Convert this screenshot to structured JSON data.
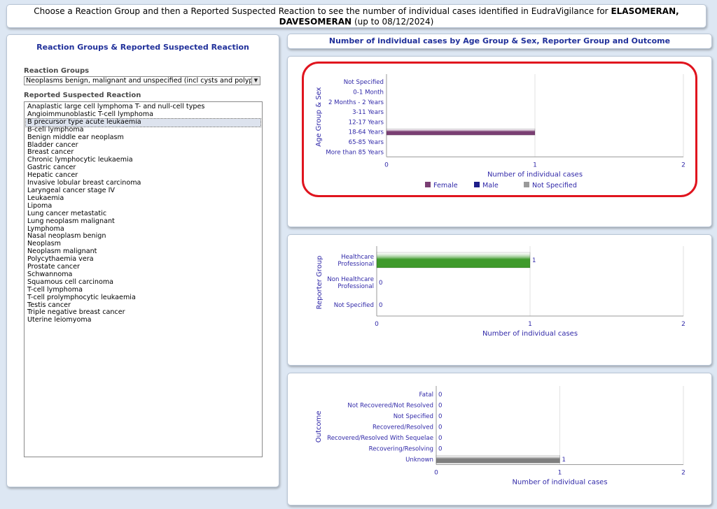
{
  "header": {
    "text": "Choose a Reaction Group and then a Reported Suspected Reaction to see the number of individual cases identified in EudraVigilance for",
    "product": "ELASOMERAN, DAVESOMERAN",
    "date_note": "(up to 08/12/2024)"
  },
  "left_panel": {
    "title": "Reaction Groups & Reported Suspected Reaction",
    "reaction_groups_label": "Reaction Groups",
    "reaction_group_selected": "Neoplasms benign, malignant and unspecified (incl cysts and polyps)",
    "reported_reaction_label": "Reported Suspected Reaction",
    "selected_reaction": "B precursor type acute leukaemia",
    "reactions": [
      "Anaplastic large cell lymphoma T- and null-cell types",
      "Angioimmunoblastic T-cell lymphoma",
      "B precursor type acute leukaemia",
      "B-cell lymphoma",
      "Benign middle ear neoplasm",
      "Bladder cancer",
      "Breast cancer",
      "Chronic lymphocytic leukaemia",
      "Gastric cancer",
      "Hepatic cancer",
      "Invasive lobular breast carcinoma",
      "Laryngeal cancer stage IV",
      "Leukaemia",
      "Lipoma",
      "Lung cancer metastatic",
      "Lung neoplasm malignant",
      "Lymphoma",
      "Nasal neoplasm benign",
      "Neoplasm",
      "Neoplasm malignant",
      "Polycythaemia vera",
      "Prostate cancer",
      "Schwannoma",
      "Squamous cell carcinoma",
      "T-cell lymphoma",
      "T-cell prolymphocytic leukaemia",
      "Testis cancer",
      "Triple negative breast cancer",
      "Uterine leiomyoma"
    ]
  },
  "right_title": "Number of individual cases by Age Group & Sex, Reporter Group and Outcome",
  "colors": {
    "female": "#7a3f73",
    "male": "#1e1e8a",
    "not_specified": "#9a9a9a",
    "reporter_bar": "#3f9a2c",
    "outcome_bar": "#7f7f7f",
    "axis_text": "#3028a8",
    "highlight": "#e0141e"
  },
  "chart_data": [
    {
      "type": "bar",
      "orientation": "horizontal",
      "categories": [
        "Not Specified",
        "0-1 Month",
        "2 Months - 2 Years",
        "3-11 Years",
        "12-17 Years",
        "18-64 Years",
        "65-85 Years",
        "More than 85 Years"
      ],
      "series": [
        {
          "name": "Female",
          "values": [
            0,
            0,
            0,
            0,
            0,
            1,
            0,
            0
          ]
        },
        {
          "name": "Male",
          "values": [
            0,
            0,
            0,
            0,
            0,
            0,
            0,
            0
          ]
        },
        {
          "name": "Not Specified",
          "values": [
            0,
            0,
            0,
            0,
            0,
            0,
            0,
            0
          ]
        }
      ],
      "xlabel": "Number of individual cases",
      "ylabel": "Age Group & Sex",
      "xlim": [
        0,
        2
      ],
      "xticks": [
        "0",
        "1",
        "2"
      ],
      "legend": "bottom"
    },
    {
      "type": "bar",
      "orientation": "horizontal",
      "categories": [
        "Healthcare Professional",
        "Non Healthcare Professional",
        "Not Specified"
      ],
      "values": [
        1,
        0,
        0
      ],
      "xlabel": "Number of individual cases",
      "ylabel": "Reporter Group",
      "xlim": [
        0,
        2
      ],
      "xticks": [
        "0",
        "1",
        "2"
      ]
    },
    {
      "type": "bar",
      "orientation": "horizontal",
      "categories": [
        "Fatal",
        "Not Recovered/Not Resolved",
        "Not Specified",
        "Recovered/Resolved",
        "Recovered/Resolved With Sequelae",
        "Recovering/Resolving",
        "Unknown"
      ],
      "values": [
        0,
        0,
        0,
        0,
        0,
        0,
        1
      ],
      "xlabel": "Number of individual cases",
      "ylabel": "Outcome",
      "xlim": [
        0,
        2
      ],
      "xticks": [
        "0",
        "1",
        "2"
      ]
    }
  ]
}
